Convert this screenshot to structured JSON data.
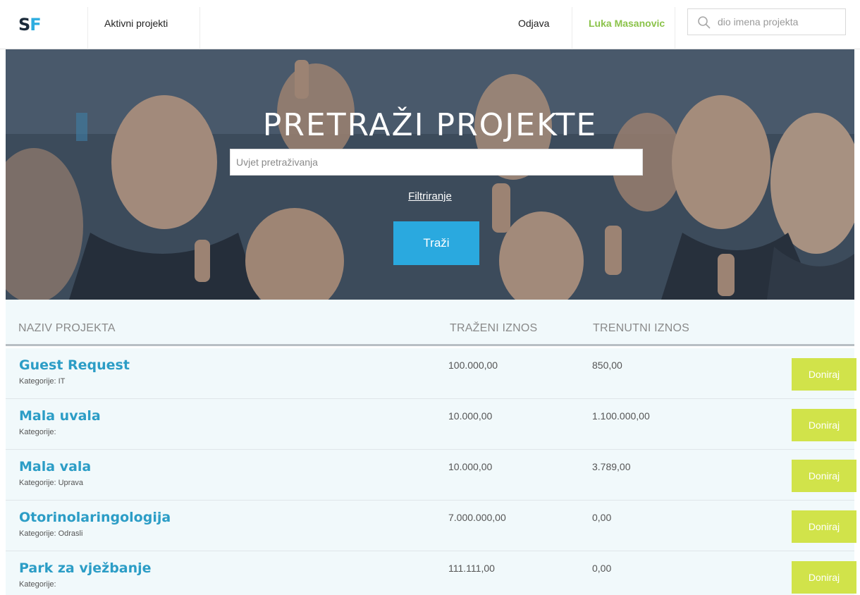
{
  "brand": {
    "logo_s": "S",
    "logo_f": "F"
  },
  "nav": {
    "active_projects": "Aktivni projekti",
    "logout": "Odjava",
    "user_name": "Luka Masanovic",
    "search_placeholder": "dio imena projekta"
  },
  "hero": {
    "title": "PRETRAŽI PROJEKTE",
    "search_placeholder": "Uvjet pretraživanja",
    "filter_label": "Filtriranje",
    "search_button": "Traži"
  },
  "table": {
    "headers": {
      "name": "NAZIV PROJEKTA",
      "requested": "TRAŽENI IZNOS",
      "current": "TRENUTNI IZNOS"
    },
    "category_label": "Kategorije:",
    "donate_label": "Doniraj",
    "rows": [
      {
        "name": "Guest Request",
        "category": "IT",
        "requested": "100.000,00",
        "current": "850,00"
      },
      {
        "name": "Mala uvala",
        "category": "",
        "requested": "10.000,00",
        "current": "1.100.000,00"
      },
      {
        "name": "Mala vala",
        "category": "Uprava",
        "requested": "10.000,00",
        "current": "3.789,00"
      },
      {
        "name": "Otorinolaringologija",
        "category": "Odrasli",
        "requested": "7.000.000,00",
        "current": "0,00"
      },
      {
        "name": "Park za vježbanje",
        "category": "",
        "requested": "111.111,00",
        "current": "0,00"
      }
    ]
  },
  "colors": {
    "accent_blue": "#2aa9df",
    "user_green": "#8bc34a",
    "donate_green": "#d1e34a",
    "link_blue": "#2c9dc6",
    "table_bg": "#f1f9fb"
  }
}
